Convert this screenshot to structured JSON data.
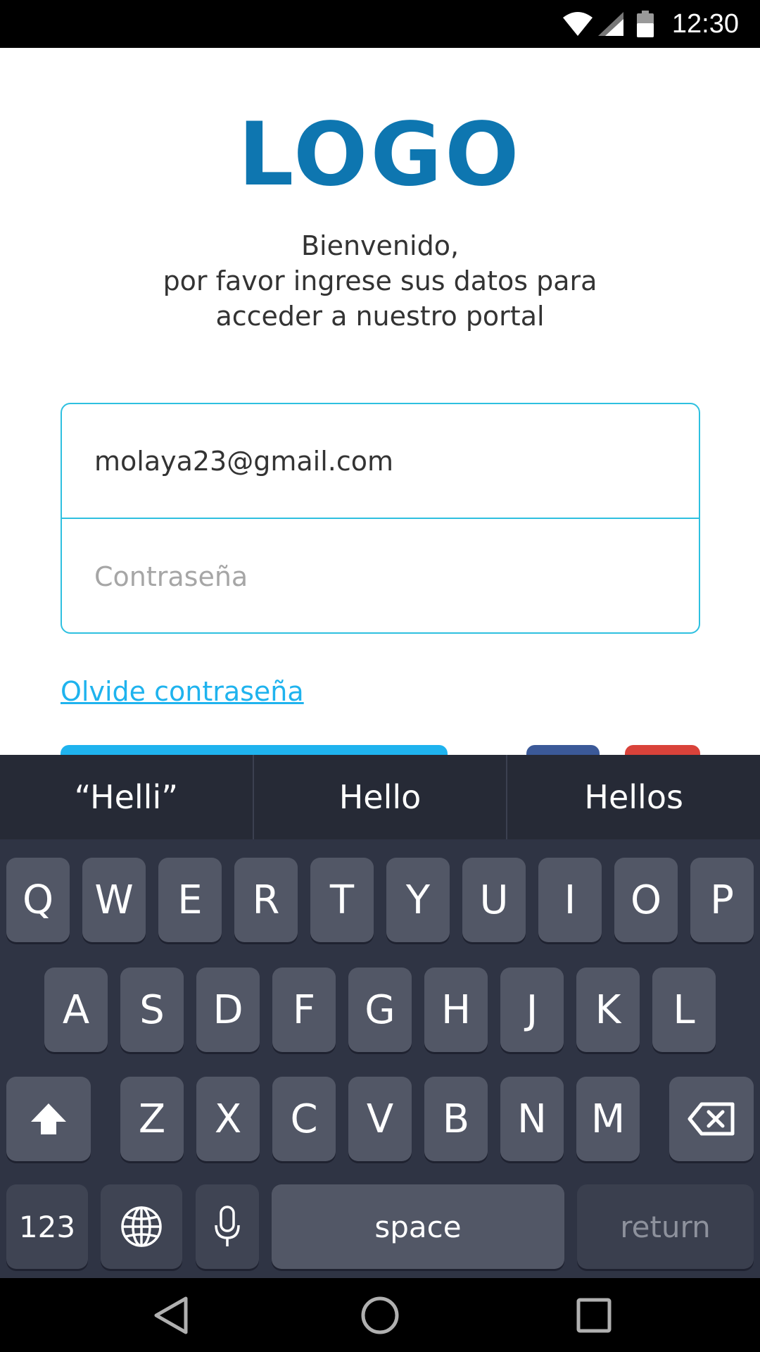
{
  "status_bar": {
    "time": "12:30",
    "icons": [
      "wifi-icon",
      "cell-signal-icon",
      "battery-icon"
    ]
  },
  "app": {
    "logo": "LOGO",
    "welcome_line1": "Bienvenido,",
    "welcome_line2": "por favor ingrese sus datos para",
    "welcome_line3": "acceder a nuestro portal",
    "email_value": "molaya23@gmail.com",
    "password_placeholder": "Contraseña",
    "forgot_link": "Olvide contraseña",
    "colors": {
      "logo": "#0e76b0",
      "accent": "#1fb3ee",
      "input_border": "#2ec0e0",
      "facebook": "#3b5998",
      "google": "#d9423a"
    }
  },
  "keyboard": {
    "suggestions": [
      "“Helli”",
      "Hello",
      "Hellos"
    ],
    "row1": [
      "Q",
      "W",
      "E",
      "R",
      "T",
      "Y",
      "U",
      "I",
      "O",
      "P"
    ],
    "row2": [
      "A",
      "S",
      "D",
      "F",
      "G",
      "H",
      "J",
      "K",
      "L"
    ],
    "row3": [
      "Z",
      "X",
      "C",
      "V",
      "B",
      "N",
      "M"
    ],
    "numbers_key": "123",
    "space_key": "space",
    "return_key": "return"
  },
  "nav_bar": {
    "buttons": [
      "back-icon",
      "home-icon",
      "recents-icon"
    ]
  }
}
